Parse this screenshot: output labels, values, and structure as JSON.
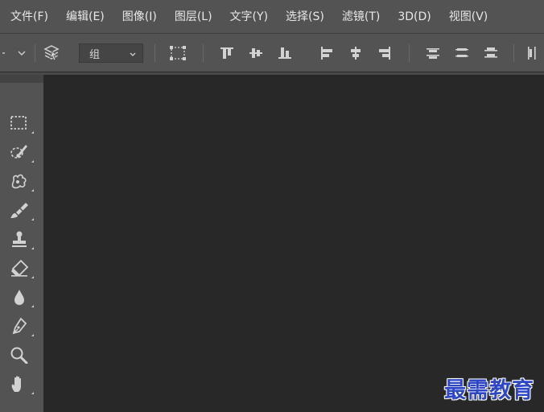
{
  "menubar": {
    "items": [
      {
        "label": "文件(F)"
      },
      {
        "label": "编辑(E)"
      },
      {
        "label": "图像(I)"
      },
      {
        "label": "图层(L)"
      },
      {
        "label": "文字(Y)"
      },
      {
        "label": "选择(S)"
      },
      {
        "label": "滤镜(T)"
      },
      {
        "label": "3D(D)"
      },
      {
        "label": "视图(V)"
      }
    ]
  },
  "options": {
    "auto_select_target": "组"
  },
  "tools": [
    "rectangular-marquee-icon",
    "quick-selection-icon",
    "spot-healing-brush-icon",
    "brush-icon",
    "clone-stamp-icon",
    "eraser-icon",
    "blur-icon",
    "pen-icon",
    "zoom-icon",
    "hand-icon"
  ],
  "watermark": {
    "text": "最需教育"
  },
  "colors": {
    "ui_gray": "#535353",
    "canvas": "#282828",
    "icon": "#d2d2d2",
    "watermark": "#2f47c4"
  }
}
